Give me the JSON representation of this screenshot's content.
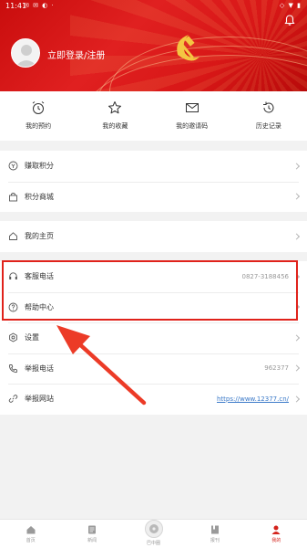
{
  "status_bar": {
    "time": "11:41",
    "icons_left": "✉ ✉ ◐ ·",
    "icons_right": "◇ ▼ ▮"
  },
  "header": {
    "login_text": "立即登录/注册"
  },
  "shortcuts": [
    {
      "label": "我的预约",
      "icon": "alarm-clock-icon"
    },
    {
      "label": "我的收藏",
      "icon": "star-icon"
    },
    {
      "label": "我的邀请码",
      "icon": "envelope-icon"
    },
    {
      "label": "历史记录",
      "icon": "history-icon"
    }
  ],
  "group1": [
    {
      "label": "赚取积分",
      "icon": "coin-icon"
    },
    {
      "label": "积分商城",
      "icon": "shop-icon"
    }
  ],
  "group2": [
    {
      "label": "我的主页",
      "icon": "home-icon"
    }
  ],
  "group3": [
    {
      "label": "客服电话",
      "icon": "headset-icon",
      "value": "0827-3188456"
    },
    {
      "label": "帮助中心",
      "icon": "help-circle-icon"
    },
    {
      "label": "设置",
      "icon": "settings-icon"
    },
    {
      "label": "举报电话",
      "icon": "phone-icon",
      "value": "962377"
    },
    {
      "label": "举报网站",
      "icon": "link-icon",
      "value": "https://www.12377.cn/"
    }
  ],
  "bottom_nav": [
    {
      "label": "首页",
      "icon": "home-tab-icon"
    },
    {
      "label": "新闻",
      "icon": "news-tab-icon"
    },
    {
      "label": "巴中圈",
      "icon": "disc-tab-icon"
    },
    {
      "label": "报刊",
      "icon": "paper-tab-icon"
    },
    {
      "label": "我的",
      "icon": "user-tab-icon",
      "active": true
    }
  ],
  "colors": {
    "brand_red": "#d81717",
    "annotation_red": "#e0221b",
    "link_blue": "#3a79c8"
  }
}
